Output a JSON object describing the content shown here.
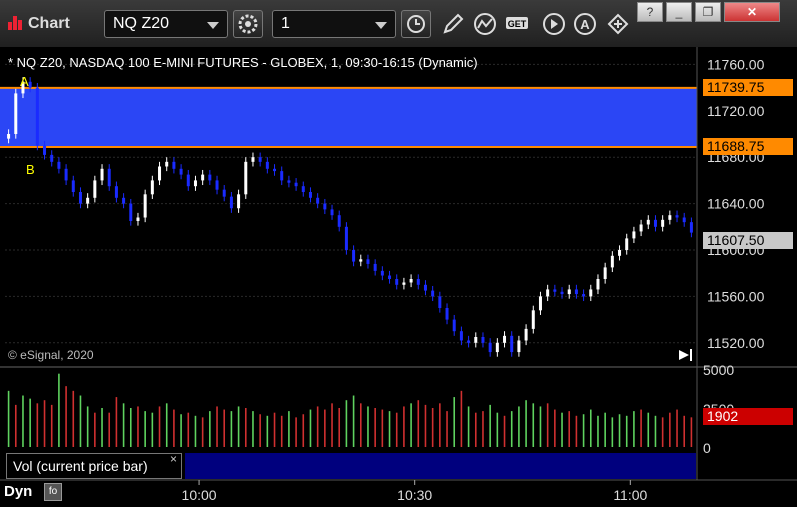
{
  "window": {
    "title": "Chart",
    "min_label": "_",
    "restore_label": "❐",
    "close_label": "✕"
  },
  "toolbar": {
    "symbol": "NQ Z20",
    "interval": "1",
    "icons": [
      "settings-gear-icon",
      "clock-icon",
      "pencil-icon",
      "line-study-icon",
      "get-icon",
      "play-icon",
      "alert-icon",
      "sync-icon"
    ]
  },
  "chart": {
    "header": "* NQ Z20, NASDAQ 100 E-MINI FUTURES - GLOBEX, 1, 09:30-16:15 (Dynamic)",
    "copyright": "© eSignal, 2020",
    "price_axis": [
      "11760.00",
      "11720.00",
      "11680.00",
      "11640.00",
      "11600.00",
      "11560.00",
      "11520.00"
    ],
    "price_tags": {
      "upper": "11739.75",
      "lower": "11688.75",
      "last": "11607.50"
    },
    "markers": {
      "a": "A",
      "b": "B"
    },
    "time_axis": [
      "10:00",
      "10:30",
      "11:00"
    ],
    "colors": {
      "band": "#2b46f5",
      "band_edge": "#ff8a00",
      "up_candle": "#ffffff",
      "down_candle": "#1a2bff",
      "vol_up": "#5fd35f",
      "vol_down": "#d03030",
      "last_tag": "#c8c8c8",
      "vol_tag": "#cc0000"
    }
  },
  "volume": {
    "label": "Vol (current price bar)",
    "close_icon": "×",
    "axis": [
      "5000",
      "2500",
      "0"
    ],
    "last_tag": "1902"
  },
  "footer": {
    "mode": "Dyn",
    "lock_icon": "fo"
  },
  "chart_data": [
    {
      "type": "candlestick",
      "title": "* NQ Z20, NASDAQ 100 E-MINI FUTURES - GLOBEX, 1, 09:30-16:15 (Dynamic)",
      "ylim": [
        11500,
        11775
      ],
      "yticks": [
        11760,
        11720,
        11680,
        11640,
        11600,
        11560,
        11520
      ],
      "x_ticks": [
        "10:00",
        "10:30",
        "11:00"
      ],
      "band": [
        11688.75,
        11739.75
      ],
      "last": 11607.5,
      "closes": [
        11700,
        11735,
        11745,
        11740,
        11690,
        11682,
        11676,
        11670,
        11660,
        11650,
        11640,
        11645,
        11660,
        11670,
        11655,
        11645,
        11640,
        11625,
        11628,
        11648,
        11660,
        11672,
        11676,
        11670,
        11665,
        11655,
        11660,
        11665,
        11660,
        11652,
        11646,
        11636,
        11648,
        11676,
        11680,
        11676,
        11670,
        11668,
        11660,
        11658,
        11655,
        11650,
        11645,
        11640,
        11635,
        11630,
        11620,
        11600,
        11590,
        11592,
        11588,
        11582,
        11578,
        11575,
        11570,
        11572,
        11575,
        11570,
        11565,
        11560,
        11550,
        11540,
        11530,
        11522,
        11520,
        11525,
        11520,
        11512,
        11520,
        11526,
        11512,
        11522,
        11532,
        11548,
        11560,
        11566,
        11564,
        11562,
        11566,
        11562,
        11560,
        11566,
        11575,
        11585,
        11595,
        11600,
        11610,
        11616,
        11622,
        11626,
        11620,
        11626,
        11630,
        11628,
        11624,
        11615
      ]
    },
    {
      "type": "bar",
      "title": "Vol (current price bar)",
      "ylim": [
        0,
        5000
      ],
      "yticks": [
        5000,
        2500,
        0
      ],
      "last": 1902,
      "values": [
        3600,
        2700,
        3300,
        3100,
        2800,
        3000,
        2700,
        4700,
        3900,
        3600,
        3300,
        2600,
        2200,
        2500,
        2200,
        3200,
        2800,
        2500,
        2600,
        2300,
        2200,
        2600,
        2800,
        2400,
        2100,
        2200,
        2000,
        1900,
        2300,
        2600,
        2400,
        2300,
        2600,
        2500,
        2300,
        2100,
        2000,
        2200,
        2000,
        2300,
        1900,
        2100,
        2400,
        2600,
        2400,
        2800,
        2500,
        3000,
        3300,
        2800,
        2600,
        2500,
        2400,
        2300,
        2200,
        2600,
        2800,
        3000,
        2700,
        2500,
        2800,
        2300,
        3200,
        3600,
        2600,
        2200,
        2300,
        2700,
        2200,
        2000,
        2300,
        2600,
        3000,
        2800,
        2600,
        2800,
        2400,
        2200,
        2300,
        2000,
        2100,
        2400,
        2000,
        2200,
        1900,
        2100,
        2000,
        2300,
        2400,
        2200,
        2000,
        1900,
        2200,
        2400,
        2000,
        1902
      ],
      "up": [
        true,
        false,
        true,
        true,
        false,
        false,
        false,
        true,
        false,
        false,
        true,
        true,
        false,
        true,
        false,
        false,
        true,
        true,
        false,
        true,
        true,
        false,
        true,
        false,
        true,
        false,
        true,
        false,
        true,
        false,
        false,
        true,
        true,
        false,
        true,
        false,
        true,
        false,
        false,
        true,
        false,
        false,
        true,
        false,
        false,
        false,
        false,
        true,
        true,
        false,
        true,
        false,
        false,
        true,
        false,
        false,
        true,
        false,
        false,
        false,
        false,
        false,
        true,
        false,
        true,
        false,
        false,
        true,
        true,
        false,
        true,
        true,
        true,
        true,
        true,
        false,
        false,
        true,
        false,
        false,
        true,
        true,
        true,
        true,
        true,
        true,
        true,
        true,
        false,
        true,
        true,
        false,
        false,
        false,
        false,
        false
      ]
    }
  ]
}
